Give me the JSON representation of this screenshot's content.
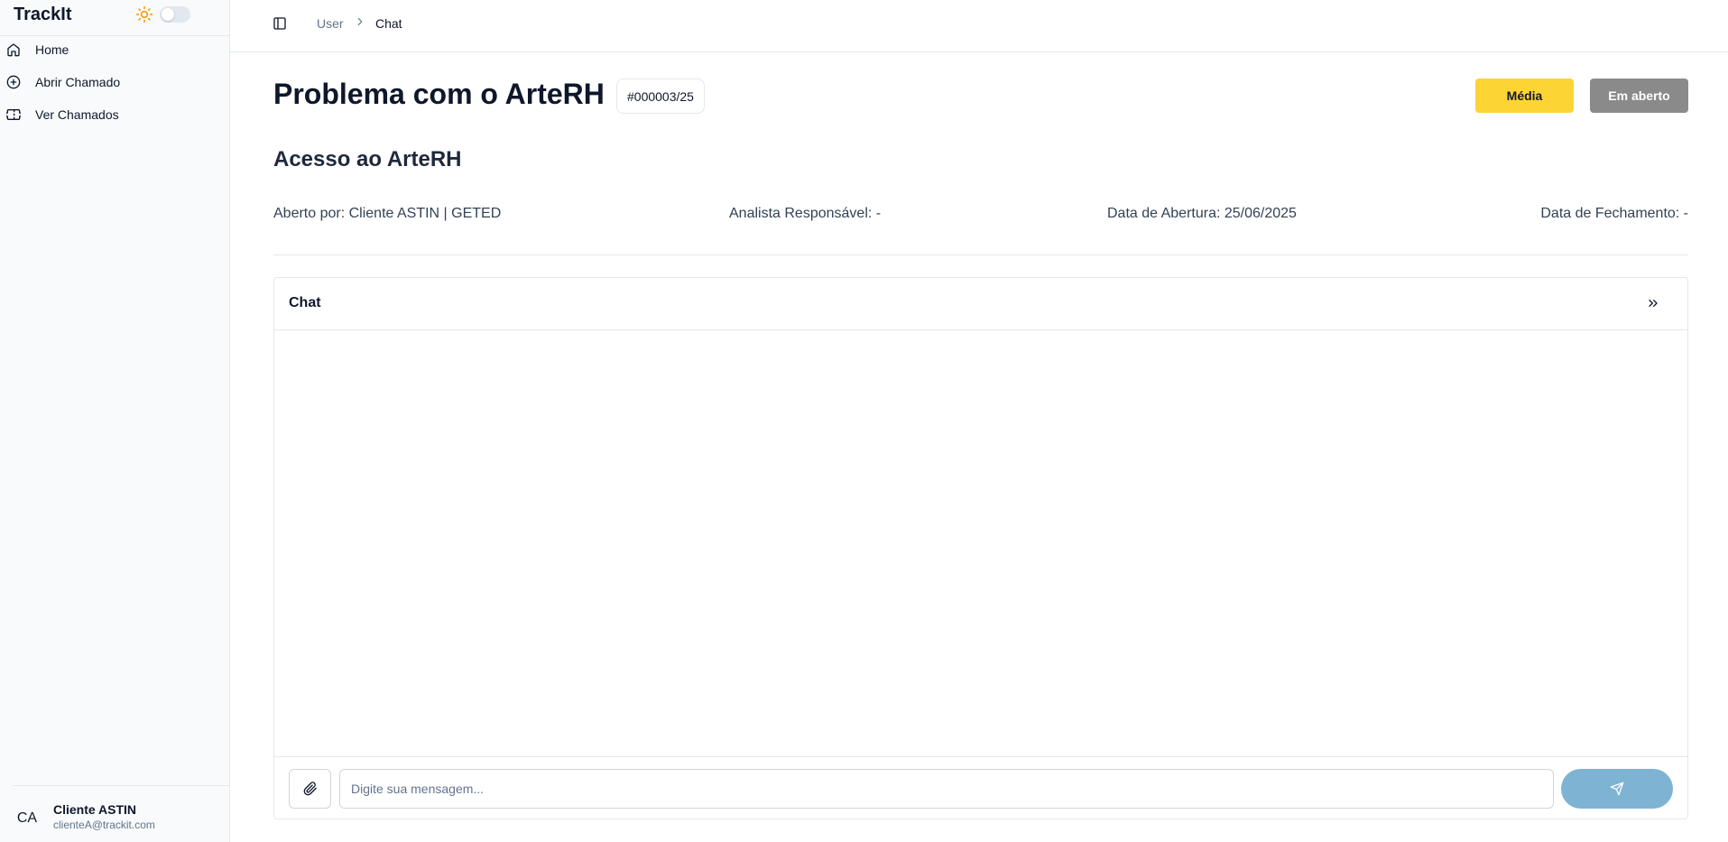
{
  "app": {
    "brand": "TrackIt"
  },
  "sidebar": {
    "items": [
      {
        "label": "Home",
        "icon": "home-icon"
      },
      {
        "label": "Abrir Chamado",
        "icon": "plus-circle-icon"
      },
      {
        "label": "Ver Chamados",
        "icon": "ticket-icon"
      }
    ],
    "theme_toggle": {
      "icon": "sun-icon",
      "state": "off"
    }
  },
  "user": {
    "initials": "CA",
    "name": "Cliente ASTIN",
    "email": "clienteA@trackit.com"
  },
  "breadcrumb": {
    "items": [
      "User",
      "Chat"
    ]
  },
  "ticket": {
    "title": "Problema com o ArteRH",
    "id": "#000003/25",
    "priority": "Média",
    "status": "Em aberto",
    "subject": "Acesso ao ArteRH",
    "opened_by": "Aberto por: Cliente ASTIN | GETED",
    "analyst": "Analista Responsável: -",
    "opened_date": "Data de Abertura: 25/06/2025",
    "closed_date": "Data de Fechamento: -"
  },
  "chat": {
    "title": "Chat",
    "placeholder": "Digite sua mensagem..."
  },
  "colors": {
    "priority_bg": "#fcd535",
    "status_bg": "#8a8a8a",
    "send_bg": "#7eb3d4",
    "sun_icon": "#f59e0b"
  }
}
